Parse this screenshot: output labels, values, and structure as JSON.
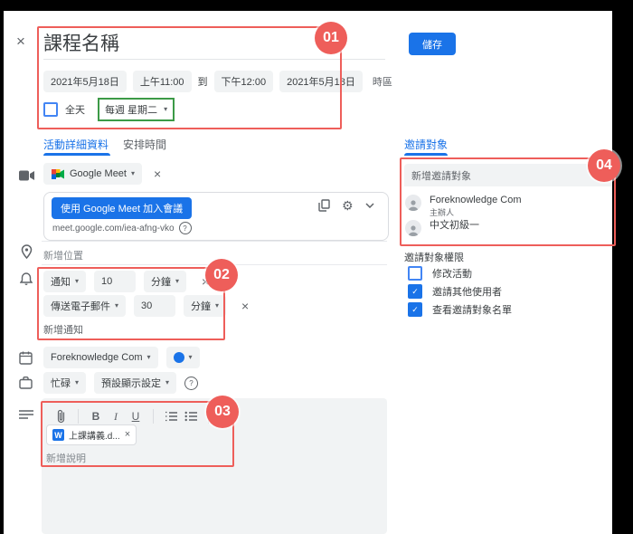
{
  "colors": {
    "accent": "#1a73e8",
    "annotation_red": "#ee5e5a",
    "highlight_green": "#3c9a47"
  },
  "icons": {
    "close": "×",
    "dropdown": "▾",
    "check": "✓",
    "help": "?",
    "gear": "⚙"
  },
  "header": {
    "title": "課程名稱",
    "save": "儲存"
  },
  "datetime": {
    "start_date": "2021年5月18日",
    "start_time": "上午11:00",
    "to_label": "到",
    "end_time": "下午12:00",
    "end_date": "2021年5月18日",
    "timezone_label": "時區",
    "all_day_label": "全天",
    "recurrence": "每週 星期二"
  },
  "tabs": {
    "event_details": "活動詳細資料",
    "schedule": "安排時間",
    "guests": "邀請對象"
  },
  "meet": {
    "provider_label": "Google Meet",
    "join_button": "使用 Google Meet 加入會議",
    "link": "meet.google.com/iea-afng-vko"
  },
  "location": {
    "placeholder": "新增位置"
  },
  "notifications": {
    "rows": [
      {
        "method": "通知",
        "value": "10",
        "unit": "分鐘"
      },
      {
        "method": "傳送電子郵件",
        "value": "30",
        "unit": "分鐘"
      }
    ],
    "add_label": "新增通知"
  },
  "calendar_row": {
    "calendar_name": "Foreknowledge Com"
  },
  "status_row": {
    "busy": "忙碌",
    "visibility": "預設顯示設定"
  },
  "description": {
    "toolbar": {
      "bold": "B",
      "italic": "I",
      "underline": "U"
    },
    "attachment_icon": "W",
    "attachment_name": "上課講義.d...",
    "placeholder": "新增說明"
  },
  "guests_panel": {
    "add_placeholder": "新增邀請對象",
    "guests": [
      {
        "name": "Foreknowledge Com",
        "role": "主辦人"
      },
      {
        "name": "中文初級一",
        "role": ""
      }
    ],
    "permissions_title": "邀請對象權限",
    "permissions": [
      {
        "label": "修改活動",
        "checked": false
      },
      {
        "label": "邀請其他使用者",
        "checked": true
      },
      {
        "label": "查看邀請對象名單",
        "checked": true
      }
    ]
  },
  "annotations": {
    "badge_01": "01",
    "badge_02": "02",
    "badge_03": "03",
    "badge_04": "04"
  }
}
